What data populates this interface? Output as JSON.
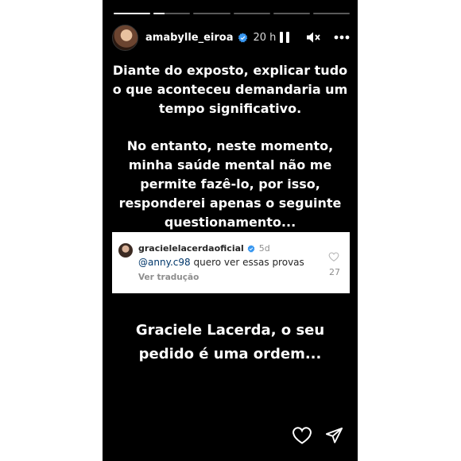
{
  "story": {
    "segments": [
      {
        "progress": 1.0
      },
      {
        "progress": 0.3
      },
      {
        "progress": 0.0
      },
      {
        "progress": 0.0
      },
      {
        "progress": 0.0
      },
      {
        "progress": 0.0
      }
    ],
    "header": {
      "username": "amabylle_eiroa",
      "time": "20 h",
      "icons": [
        "pause-icon",
        "mute-icon",
        "more-icon"
      ]
    },
    "text_block_1": "Diante do exposto, explicar tudo o que aconteceu demandaria um tempo significativo.",
    "text_block_2": "No entanto, neste momento, minha saúde mental não me permite fazê-lo, por isso, responderei apenas o seguinte questionamento...",
    "comment": {
      "username": "gracielelacerdaoficial",
      "time": "5d",
      "mention": "@anny.c98",
      "text": "quero ver essas provas",
      "translate": "Ver tradução",
      "likes": "27"
    },
    "text_block_3": "Graciele Lacerda, o seu pedido é uma ordem...",
    "bottom_icons": [
      "heart-icon",
      "send-icon"
    ],
    "colors": {
      "background": "#000000",
      "verified": "#3897f0",
      "mention": "#00376b"
    }
  }
}
